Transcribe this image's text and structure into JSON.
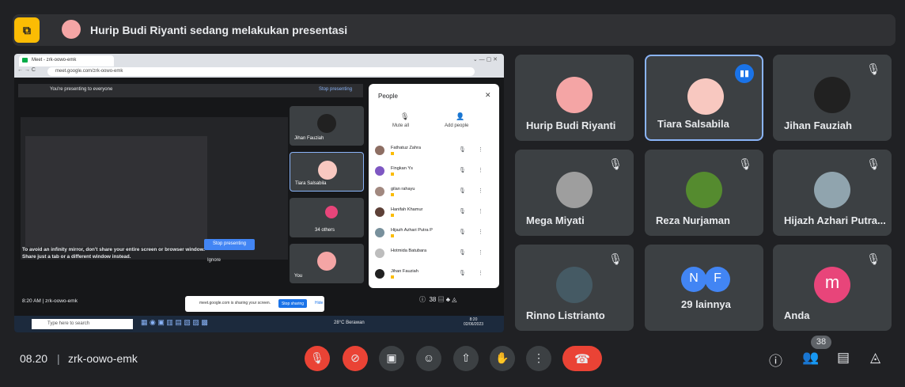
{
  "top_banner": {
    "text": "Hurip Budi Riyanti sedang melakukan presentasi",
    "icon": "presentation-icon"
  },
  "shared_screen": {
    "browser_tab": "Meet - zrk-oowo-emk",
    "url": "meet.google.com/zrk-oowo-emk",
    "presenting_text": "You're presenting to everyone",
    "stop_presenting_link": "Stop presenting",
    "mirror_warning": "To avoid an infinity mirror, don't share your entire screen or browser window. Share just a tab or a different window instead.",
    "stop_presenting_button": "Stop presenting",
    "ignore_button": "Ignore",
    "tiles": [
      {
        "name": "Jihan Fauziah"
      },
      {
        "name": "Tiara Salsabila"
      },
      {
        "name": "34 others"
      },
      {
        "name": "You"
      }
    ],
    "people_panel": {
      "title": "People",
      "mute_all": "Mute all",
      "add_people": "Add people",
      "participants": [
        {
          "name": "Fathatuz Zahra",
          "color": "#8d6e63"
        },
        {
          "name": "Fingkan Ys",
          "color": "#7e57c2"
        },
        {
          "name": "gilan rahayu",
          "color": "#a1887f"
        },
        {
          "name": "Hanifah Khamur",
          "color": "#5d4037"
        },
        {
          "name": "Hijazh Azhari Putra P",
          "color": "#78909c"
        },
        {
          "name": "Hotmida Batubara",
          "color": "#bdbdbd"
        },
        {
          "name": "Jihan Fauziah",
          "color": "#212121"
        }
      ]
    },
    "time_code": "8:20 AM | zrk-oowo-emk",
    "share_notice": "meet.google.com is sharing your screen.",
    "stop_sharing": "Stop sharing",
    "hide": "Hide",
    "participant_count": "38",
    "taskbar": {
      "search": "Type here to search",
      "weather": "28°C Berawan",
      "clock": "8:20",
      "date": "02/06/2023"
    }
  },
  "tiles": [
    {
      "name": "Hurip Budi Riyanti",
      "color": "#f4a5a5",
      "muted": false
    },
    {
      "name": "Tiara Salsabila",
      "color": "#f8c8c0",
      "speaking": true
    },
    {
      "name": "Jihan Fauziah",
      "color": "#212121",
      "muted": true
    },
    {
      "name": "Mega Miyati",
      "color": "#9e9e9e",
      "muted": true
    },
    {
      "name": "Reza Nurjaman",
      "color": "#558b2f",
      "muted": true
    },
    {
      "name": "Hijazh Azhari Putra...",
      "color": "#90a4ae",
      "muted": true
    },
    {
      "name": "Rinno Listrianto",
      "color": "#455a64",
      "muted": true
    },
    {
      "name": "29 lainnya",
      "avatars": [
        "N",
        "F"
      ],
      "avatar_colors": [
        "#4285f4",
        "#4285f4"
      ]
    },
    {
      "name": "Anda",
      "avatar": "m",
      "color": "#e8457a",
      "muted": true
    }
  ],
  "bottom_bar": {
    "time": "08.20",
    "separator": "|",
    "meeting_code": "zrk-oowo-emk",
    "people_count": "38"
  }
}
